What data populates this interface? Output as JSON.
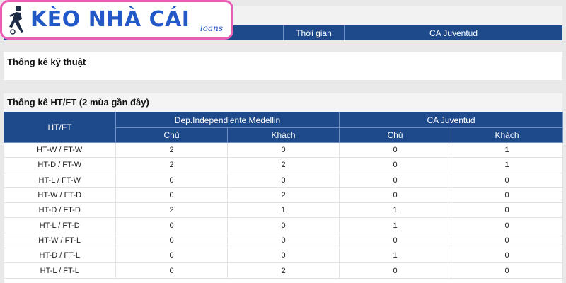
{
  "logo": {
    "text": "KÈO NHÀ CÁI",
    "sub": "loans"
  },
  "top_header": {
    "time_label": "Thời gian",
    "team": "CA Juventud"
  },
  "tech_section": {
    "title": "Thống kê kỹ thuật"
  },
  "htft_section": {
    "title": "Thống kê HT/FT (2 mùa gần đây)",
    "first_col_label": "HT/FT",
    "team_home": "Dep.Independiente Medellin",
    "team_away": "CA Juventud",
    "sub_home": "Chủ",
    "sub_away": "Khách",
    "rows": [
      {
        "label": "HT-W / FT-W",
        "v": [
          "2",
          "0",
          "0",
          "1"
        ]
      },
      {
        "label": "HT-D / FT-W",
        "v": [
          "2",
          "2",
          "0",
          "1"
        ]
      },
      {
        "label": "HT-L / FT-W",
        "v": [
          "0",
          "0",
          "0",
          "0"
        ]
      },
      {
        "label": "HT-W / FT-D",
        "v": [
          "0",
          "2",
          "0",
          "0"
        ]
      },
      {
        "label": "HT-D / FT-D",
        "v": [
          "2",
          "1",
          "1",
          "0"
        ]
      },
      {
        "label": "HT-L / FT-D",
        "v": [
          "0",
          "0",
          "1",
          "0"
        ]
      },
      {
        "label": "HT-W / FT-L",
        "v": [
          "0",
          "0",
          "0",
          "0"
        ]
      },
      {
        "label": "HT-D / FT-L",
        "v": [
          "0",
          "0",
          "1",
          "0"
        ]
      },
      {
        "label": "HT-L / FT-L",
        "v": [
          "0",
          "2",
          "0",
          "0"
        ]
      }
    ]
  }
}
